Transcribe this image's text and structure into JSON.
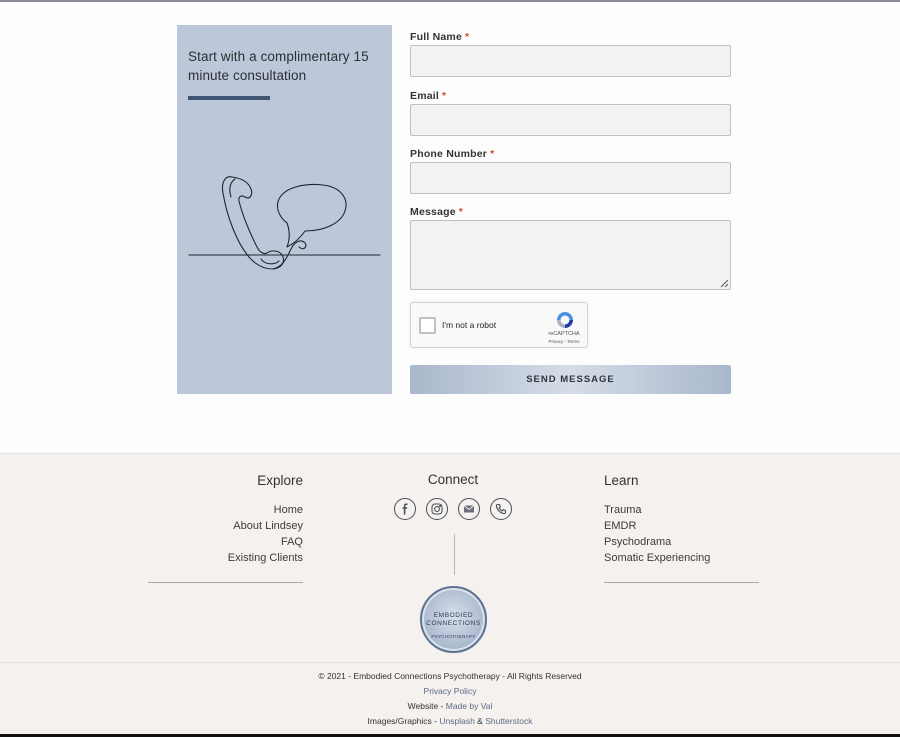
{
  "panel": {
    "title": "Start with a complimentary 15 minute consultation"
  },
  "form": {
    "fields": [
      {
        "label": "Full Name",
        "required": "*",
        "value": ""
      },
      {
        "label": "Email",
        "required": "*",
        "value": ""
      },
      {
        "label": "Phone Number",
        "required": "*",
        "value": ""
      },
      {
        "label": "Message",
        "required": "*",
        "value": ""
      }
    ],
    "captcha": {
      "label": "I'm not a robot",
      "brand": "reCAPTCHA",
      "links": "Privacy - Terms"
    },
    "submit_label": "SEND MESSAGE"
  },
  "footer": {
    "explore": {
      "heading": "Explore",
      "links": [
        "Home",
        "About Lindsey",
        "FAQ",
        "Existing Clients"
      ]
    },
    "connect": {
      "heading": "Connect",
      "icons": [
        "facebook-icon",
        "instagram-icon",
        "mail-icon",
        "phone-icon"
      ]
    },
    "learn": {
      "heading": "Learn",
      "links": [
        "Trauma",
        "EMDR",
        "Psychodrama",
        "Somatic Experiencing"
      ]
    },
    "badge": {
      "line1": "EMBODIED",
      "line2": "CONNECTIONS",
      "line3": "PSYCHOTHERAPY"
    },
    "copyright": "© 2021 - Embodied Connections Psychotherapy - All Rights Reserved",
    "privacy": "Privacy Policy",
    "website_prefix": "Website - ",
    "website_link": "Made by Val",
    "images_prefix": "Images/Graphics - ",
    "images_link1": "Unsplash",
    "images_amp": " & ",
    "images_link2": "Shutterstock"
  },
  "colors": {
    "panel_bg": "#bcc8d9",
    "accent_bar": "#3e5574",
    "required": "#d0492c",
    "footer_bg": "#f4f1ee",
    "link": "#5b6a85"
  }
}
